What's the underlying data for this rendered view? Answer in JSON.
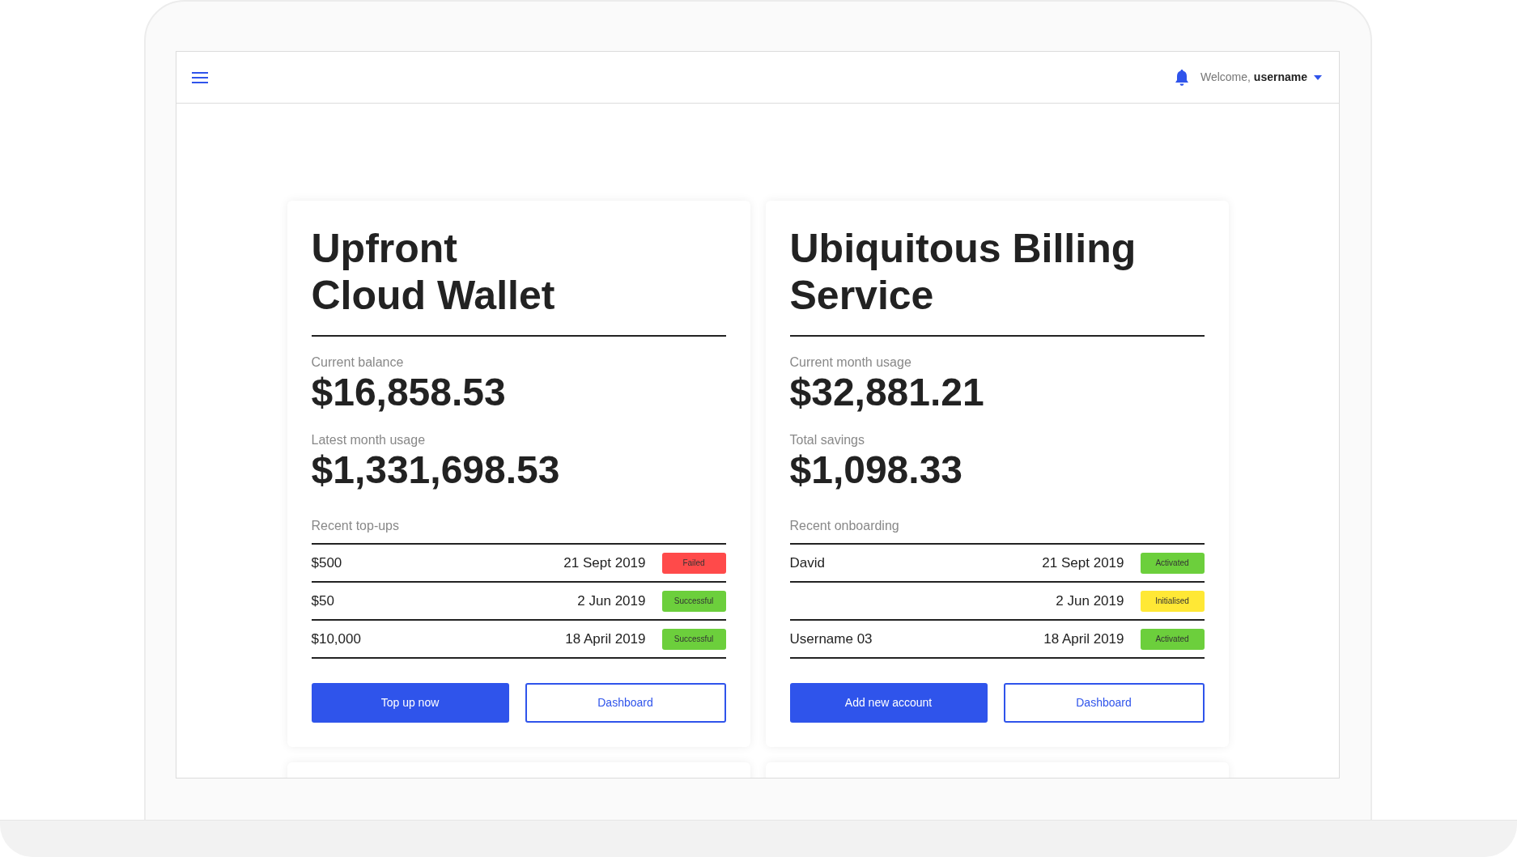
{
  "header": {
    "welcome": "Welcome,",
    "username": "username"
  },
  "cards": [
    {
      "title": "Upfront\nCloud Wallet",
      "metrics": [
        {
          "label": "Current balance",
          "value": "$16,858.53"
        },
        {
          "label": "Latest month usage",
          "value": "$1,331,698.53"
        }
      ],
      "list_title": "Recent top-ups",
      "rows": [
        {
          "name": "$500",
          "date": "21 Sept 2019",
          "status": "Failed",
          "color": "#ff4a4a"
        },
        {
          "name": "$50",
          "date": "2 Jun 2019",
          "status": "Successful",
          "color": "#6ccf3c"
        },
        {
          "name": "$10,000",
          "date": "18 April 2019",
          "status": "Successful",
          "color": "#6ccf3c"
        }
      ],
      "primary_button": "Top up now",
      "secondary_button": "Dashboard"
    },
    {
      "title": "Ubiquitous Billing\nService",
      "metrics": [
        {
          "label": "Current month usage",
          "value": "$32,881.21"
        },
        {
          "label": "Total savings",
          "value": "$1,098.33"
        }
      ],
      "list_title": "Recent onboarding",
      "rows": [
        {
          "name": "David",
          "date": "21 Sept 2019",
          "status": "Activated",
          "color": "#6ccf3c"
        },
        {
          "date": "2 Jun 2019",
          "status": "Initialised",
          "color": "#ffe835"
        },
        {
          "name": "Username 03",
          "date": "18 April 2019",
          "status": "Activated",
          "color": "#6ccf3c"
        }
      ],
      "primary_button": "Add new account",
      "secondary_button": "Dashboard"
    }
  ]
}
